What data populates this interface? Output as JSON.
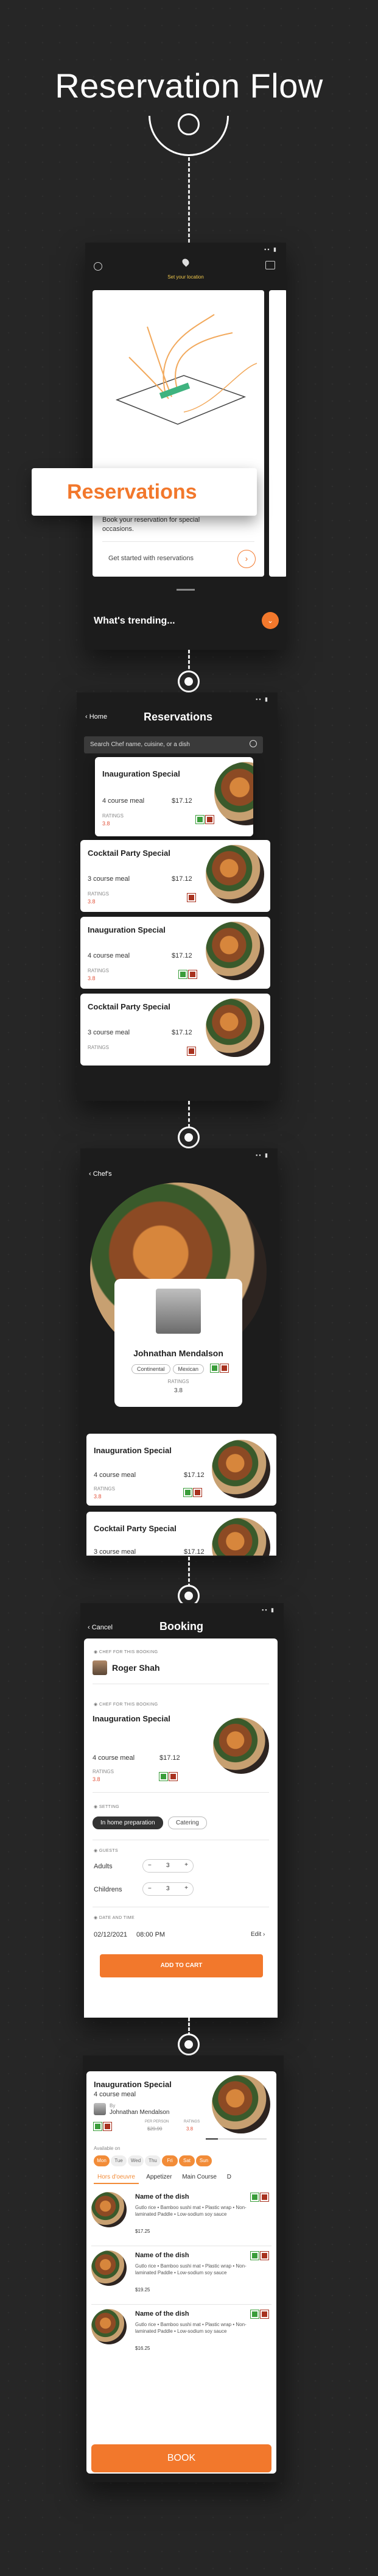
{
  "header": {
    "title": "Reservation Flow"
  },
  "screen1": {
    "location_label": "Set your location",
    "badge_label": "Reservations",
    "desc": "Book your reservation for special occasions.",
    "cta": "Get started with reservations",
    "trending": "What's trending..."
  },
  "screen2": {
    "back_label": "Home",
    "title": "Reservations",
    "search_placeholder": "Search Chef name, cuisine, or a dish",
    "cards": [
      {
        "name": "Inauguration Special",
        "meal": "4 course meal",
        "price": "$17.12",
        "rating_label": "RATINGS",
        "rating": "3.8"
      },
      {
        "name": "Cocktail Party Special",
        "meal": "3 course meal",
        "price": "$17.12",
        "rating_label": "RATINGS",
        "rating": "3.8"
      },
      {
        "name": "Inauguration Special",
        "meal": "4 course meal",
        "price": "$17.12",
        "rating_label": "RATINGS",
        "rating": "3.8"
      },
      {
        "name": "Cocktail Party Special",
        "meal": "3 course meal",
        "price": "$17.12",
        "rating_label": "RATINGS",
        "rating": ""
      }
    ]
  },
  "screen3": {
    "back_label": "Chef's",
    "chef_name": "Johnathan Mendalson",
    "tags": [
      "Continental",
      "Mexican"
    ],
    "rating_label": "RATINGS",
    "rating": "3.8",
    "cards": [
      {
        "name": "Inauguration Special",
        "meal": "4 course meal",
        "price": "$17.12",
        "rating_label": "RATINGS",
        "rating": "3.8"
      },
      {
        "name": "Cocktail Party Special",
        "meal": "3 course meal",
        "price": "$17.12"
      }
    ]
  },
  "screen4": {
    "cancel_label": "Cancel",
    "title": "Booking",
    "chef_section": "CHEF FOR THIS BOOKING",
    "chef_name": "Roger Shah",
    "menu_section": "CHEF FOR THIS BOOKING",
    "menu_name": "Inauguration Special",
    "meal": "4 course meal",
    "price": "$17.12",
    "rating_label": "RATINGS",
    "rating": "3.8",
    "setting_section": "SETTING",
    "setting_options": [
      "In home preparation",
      "Catering"
    ],
    "guests_section": "GUESTS",
    "adults_label": "Adults",
    "adults_value": "3",
    "children_label": "Childrens",
    "children_value": "3",
    "datetime_section": "DATE AND TIME",
    "date": "02/12/2021",
    "time": "08:00 PM",
    "edit_label": "Edit",
    "add_to_cart": "ADD TO CART"
  },
  "screen5": {
    "title": "Inauguration Special",
    "meal": "4 course meal",
    "by_label": "By",
    "chef_name": "Johnathan Mendalson",
    "price_label": "PER PERSON",
    "price": "$29.99",
    "rating_label": "RATINGS",
    "rating": "3.8",
    "available_label": "Available on",
    "days": [
      "Mon",
      "Tue",
      "Wed",
      "Thu",
      "Fri",
      "Sat",
      "Sun"
    ],
    "tabs": [
      "Hors d'oeuvre",
      "Appetizer",
      "Main Course",
      "D"
    ],
    "dishes": [
      {
        "name": "Name of the dish",
        "desc": "Gutlo rice • Bamboo sushi mat • Plastic wrap • Non-laminated Paddle • Low-sodium soy sauce",
        "price": "$17.25"
      },
      {
        "name": "Name of the dish",
        "desc": "Gutlo rice • Bamboo sushi mat • Plastic wrap • Non-laminated Paddle • Low-sodium soy sauce",
        "price": "$19.25"
      },
      {
        "name": "Name of the dish",
        "desc": "Gutlo rice • Bamboo sushi mat • Plastic wrap • Non-laminated Paddle • Low-sodium soy sauce",
        "price": "$16.25"
      }
    ],
    "book_label": "BOOK"
  },
  "colors": {
    "accent": "#f2782c",
    "background": "#262626",
    "veg": "#3a9d3a",
    "nonveg": "#a8321f"
  }
}
